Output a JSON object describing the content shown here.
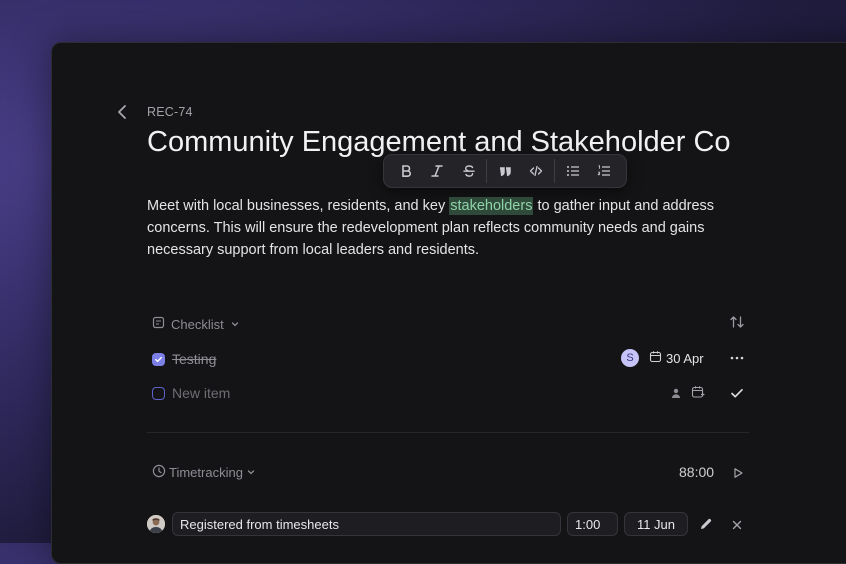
{
  "record": {
    "id": "REC-74",
    "title": "Community Engagement and Stakeholder Co"
  },
  "toolbar": {
    "buttons": [
      "bold",
      "italic",
      "strikethrough",
      "quote",
      "code",
      "bullet-list",
      "numbered-list"
    ]
  },
  "description": {
    "before": "Meet with local businesses, residents, and key ",
    "highlight": "stakeholders",
    "after": " to gather input and address concerns. This will ensure the redevelopment plan reflects community needs and gains necessary support from local leaders and residents."
  },
  "checklist": {
    "label": "Checklist",
    "items": [
      {
        "text": "Testing",
        "done": true,
        "assignee_initial": "S",
        "due": "30 Apr"
      }
    ],
    "new_item_placeholder": "New item"
  },
  "timetracking": {
    "label": "Timetracking",
    "total": "88:00",
    "entry": {
      "description": "Registered from timesheets",
      "duration": "1:00",
      "date": "11 Jun"
    }
  },
  "colors": {
    "accent": "#7b7fe6",
    "highlight_bg": "#2f4a3a",
    "highlight_text": "#8fd3a8"
  }
}
